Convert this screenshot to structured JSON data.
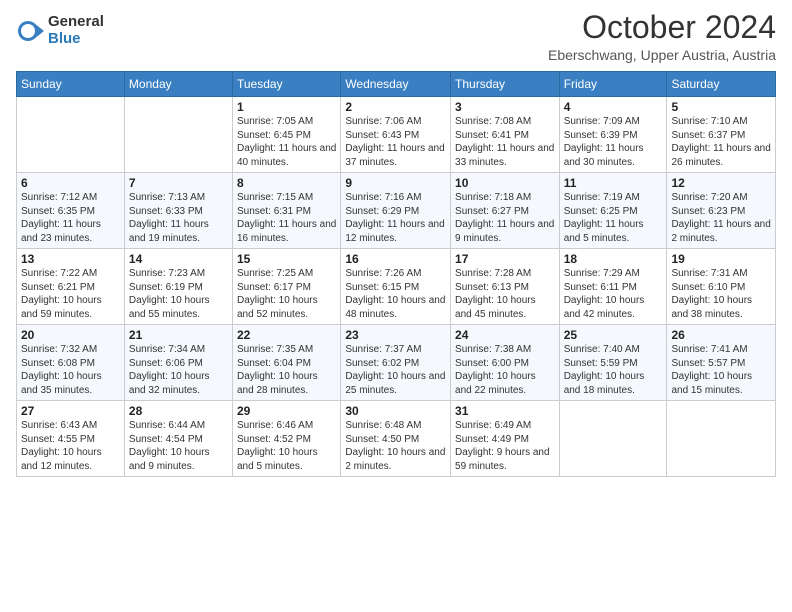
{
  "logo": {
    "general": "General",
    "blue": "Blue"
  },
  "title": "October 2024",
  "subtitle": "Eberschwang, Upper Austria, Austria",
  "weekdays": [
    "Sunday",
    "Monday",
    "Tuesday",
    "Wednesday",
    "Thursday",
    "Friday",
    "Saturday"
  ],
  "weeks": [
    [
      {
        "day": "",
        "info": ""
      },
      {
        "day": "",
        "info": ""
      },
      {
        "day": "1",
        "info": "Sunrise: 7:05 AM\nSunset: 6:45 PM\nDaylight: 11 hours and 40 minutes."
      },
      {
        "day": "2",
        "info": "Sunrise: 7:06 AM\nSunset: 6:43 PM\nDaylight: 11 hours and 37 minutes."
      },
      {
        "day": "3",
        "info": "Sunrise: 7:08 AM\nSunset: 6:41 PM\nDaylight: 11 hours and 33 minutes."
      },
      {
        "day": "4",
        "info": "Sunrise: 7:09 AM\nSunset: 6:39 PM\nDaylight: 11 hours and 30 minutes."
      },
      {
        "day": "5",
        "info": "Sunrise: 7:10 AM\nSunset: 6:37 PM\nDaylight: 11 hours and 26 minutes."
      }
    ],
    [
      {
        "day": "6",
        "info": "Sunrise: 7:12 AM\nSunset: 6:35 PM\nDaylight: 11 hours and 23 minutes."
      },
      {
        "day": "7",
        "info": "Sunrise: 7:13 AM\nSunset: 6:33 PM\nDaylight: 11 hours and 19 minutes."
      },
      {
        "day": "8",
        "info": "Sunrise: 7:15 AM\nSunset: 6:31 PM\nDaylight: 11 hours and 16 minutes."
      },
      {
        "day": "9",
        "info": "Sunrise: 7:16 AM\nSunset: 6:29 PM\nDaylight: 11 hours and 12 minutes."
      },
      {
        "day": "10",
        "info": "Sunrise: 7:18 AM\nSunset: 6:27 PM\nDaylight: 11 hours and 9 minutes."
      },
      {
        "day": "11",
        "info": "Sunrise: 7:19 AM\nSunset: 6:25 PM\nDaylight: 11 hours and 5 minutes."
      },
      {
        "day": "12",
        "info": "Sunrise: 7:20 AM\nSunset: 6:23 PM\nDaylight: 11 hours and 2 minutes."
      }
    ],
    [
      {
        "day": "13",
        "info": "Sunrise: 7:22 AM\nSunset: 6:21 PM\nDaylight: 10 hours and 59 minutes."
      },
      {
        "day": "14",
        "info": "Sunrise: 7:23 AM\nSunset: 6:19 PM\nDaylight: 10 hours and 55 minutes."
      },
      {
        "day": "15",
        "info": "Sunrise: 7:25 AM\nSunset: 6:17 PM\nDaylight: 10 hours and 52 minutes."
      },
      {
        "day": "16",
        "info": "Sunrise: 7:26 AM\nSunset: 6:15 PM\nDaylight: 10 hours and 48 minutes."
      },
      {
        "day": "17",
        "info": "Sunrise: 7:28 AM\nSunset: 6:13 PM\nDaylight: 10 hours and 45 minutes."
      },
      {
        "day": "18",
        "info": "Sunrise: 7:29 AM\nSunset: 6:11 PM\nDaylight: 10 hours and 42 minutes."
      },
      {
        "day": "19",
        "info": "Sunrise: 7:31 AM\nSunset: 6:10 PM\nDaylight: 10 hours and 38 minutes."
      }
    ],
    [
      {
        "day": "20",
        "info": "Sunrise: 7:32 AM\nSunset: 6:08 PM\nDaylight: 10 hours and 35 minutes."
      },
      {
        "day": "21",
        "info": "Sunrise: 7:34 AM\nSunset: 6:06 PM\nDaylight: 10 hours and 32 minutes."
      },
      {
        "day": "22",
        "info": "Sunrise: 7:35 AM\nSunset: 6:04 PM\nDaylight: 10 hours and 28 minutes."
      },
      {
        "day": "23",
        "info": "Sunrise: 7:37 AM\nSunset: 6:02 PM\nDaylight: 10 hours and 25 minutes."
      },
      {
        "day": "24",
        "info": "Sunrise: 7:38 AM\nSunset: 6:00 PM\nDaylight: 10 hours and 22 minutes."
      },
      {
        "day": "25",
        "info": "Sunrise: 7:40 AM\nSunset: 5:59 PM\nDaylight: 10 hours and 18 minutes."
      },
      {
        "day": "26",
        "info": "Sunrise: 7:41 AM\nSunset: 5:57 PM\nDaylight: 10 hours and 15 minutes."
      }
    ],
    [
      {
        "day": "27",
        "info": "Sunrise: 6:43 AM\nSunset: 4:55 PM\nDaylight: 10 hours and 12 minutes."
      },
      {
        "day": "28",
        "info": "Sunrise: 6:44 AM\nSunset: 4:54 PM\nDaylight: 10 hours and 9 minutes."
      },
      {
        "day": "29",
        "info": "Sunrise: 6:46 AM\nSunset: 4:52 PM\nDaylight: 10 hours and 5 minutes."
      },
      {
        "day": "30",
        "info": "Sunrise: 6:48 AM\nSunset: 4:50 PM\nDaylight: 10 hours and 2 minutes."
      },
      {
        "day": "31",
        "info": "Sunrise: 6:49 AM\nSunset: 4:49 PM\nDaylight: 9 hours and 59 minutes."
      },
      {
        "day": "",
        "info": ""
      },
      {
        "day": "",
        "info": ""
      }
    ]
  ]
}
